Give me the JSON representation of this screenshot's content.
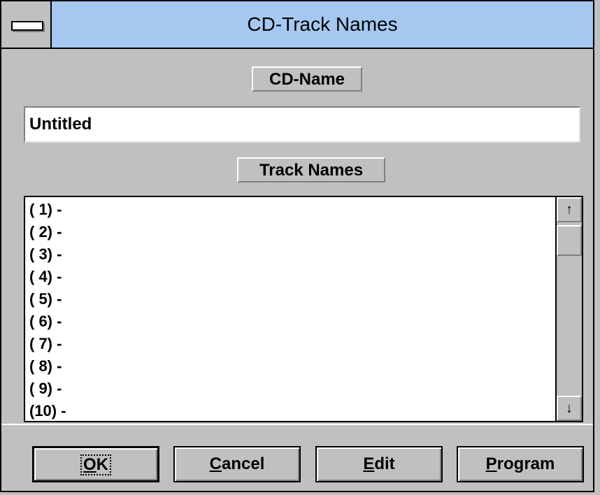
{
  "window": {
    "title": "CD-Track Names"
  },
  "cd_name": {
    "caption": "CD-Name",
    "value": "Untitled"
  },
  "tracks": {
    "caption": "Track Names",
    "items": [
      "( 1) -",
      "( 2) -",
      "( 3) -",
      "( 4) -",
      "( 5) -",
      "( 6) -",
      "( 7) -",
      "( 8) -",
      "( 9) -",
      "(10) -"
    ]
  },
  "scroll": {
    "up_icon": "↑",
    "down_icon": "↓"
  },
  "buttons": {
    "ok": {
      "mnemonic": "O",
      "rest": "K"
    },
    "cancel": {
      "mnemonic": "C",
      "rest": "ancel"
    },
    "edit": {
      "mnemonic": "E",
      "rest": "dit"
    },
    "program": {
      "mnemonic": "P",
      "rest": "rogram"
    }
  }
}
